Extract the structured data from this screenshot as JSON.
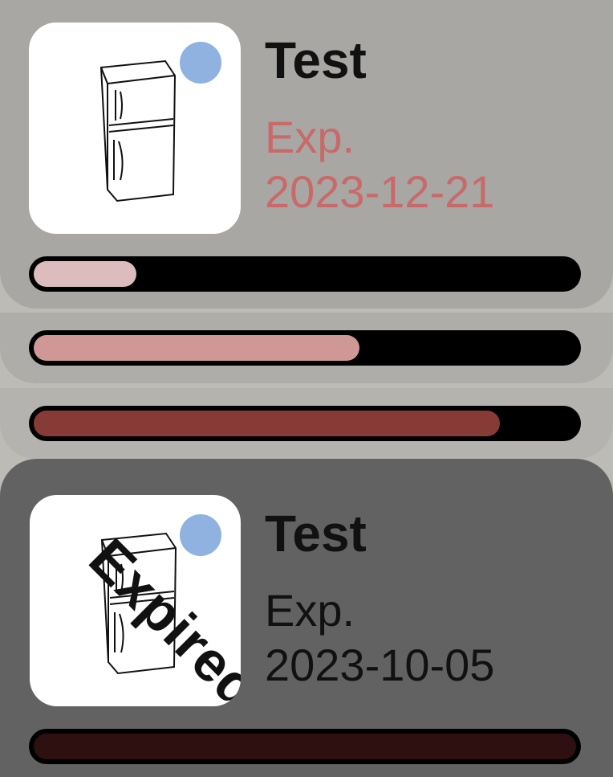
{
  "items": [
    {
      "title": "Test",
      "exp_label": "Exp.",
      "exp_date": "2023-12-21",
      "exp_color": "#c96a6a",
      "status_dot_color": "#8fb2e0",
      "progress": 0.19,
      "progress_color": "#dcbcbc"
    },
    {
      "progress": 0.6,
      "progress_color": "#cf9896"
    },
    {
      "progress": 0.86,
      "progress_color": "#873b37"
    },
    {
      "title": "Test",
      "exp_label": "Exp.",
      "exp_date": "2023-10-05",
      "exp_color": "#111111",
      "status_dot_color": "#8fb2e0",
      "stamp": "Expired",
      "progress": 1.0,
      "progress_color": "#2e1010"
    }
  ],
  "icons": {
    "thumbnail": "refrigerator-icon",
    "status": "status-dot-icon"
  }
}
